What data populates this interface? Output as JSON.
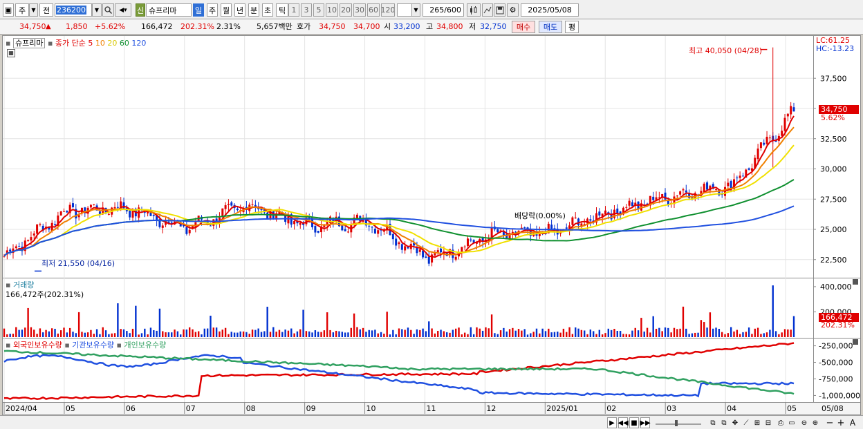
{
  "toolbar": {
    "period_label": "주",
    "prev_label": "전",
    "stock_code": "236200",
    "badge_new": "신",
    "stock_name": "슈프리마",
    "interval_tabs": [
      "일",
      "주",
      "월",
      "년",
      "분",
      "초",
      "틱"
    ],
    "minute_options": [
      "1",
      "3",
      "5",
      "10",
      "20",
      "30",
      "60",
      "120"
    ],
    "count_current": "265",
    "count_total": "/600",
    "date": "2025/05/08"
  },
  "quote": {
    "price": "34,750",
    "change": "1,850",
    "change_pct": "+5.62%",
    "volume": "166,472",
    "volume_ratio": "202.31%",
    "turnover": "2.31%",
    "amount": "5,657백만",
    "ask_label": "호가",
    "ask": "34,750",
    "bid": "34,700",
    "open_label": "시",
    "open": "33,200",
    "high_label": "고",
    "high": "34,800",
    "low_label": "저",
    "low": "32,750",
    "buy_label": "매수",
    "sell_label": "매도",
    "eval_label": "평"
  },
  "price_panel": {
    "name": "슈프리마",
    "ma_label": "종가 단순",
    "ma_periods": [
      "5",
      "10",
      "20",
      "60",
      "120"
    ],
    "ma_colors": [
      "#e00000",
      "#f08000",
      "#f0e000",
      "#109030",
      "#2050e0"
    ],
    "high_annotation": "최고 40,050 (04/28)",
    "low_annotation": "최저 21,550 (04/16)",
    "dividend_annotation": "배당락(0.00%)",
    "lc": "LC:61.25",
    "hc": "HC:-13.23",
    "price_tag": "34,750",
    "pct_tag": "5.62%",
    "y_ticks": [
      "37,500",
      "35,000",
      "32,500",
      "30,000",
      "27,500",
      "25,000",
      "22,500"
    ]
  },
  "volume_panel": {
    "title": "거래량",
    "value": "166,472주(202.31%)",
    "y_ticks": [
      "400,000",
      "200,000"
    ],
    "tag": "166,472",
    "tag_pct": "202.31%"
  },
  "holdings_panel": {
    "foreign": "외국인보유수량",
    "institution": "기관보유수량",
    "individual": "개인보유수량",
    "colors": [
      "#e00000",
      "#2050e0",
      "#30a060"
    ],
    "y_ticks": [
      "-250,000",
      "-500,000",
      "-750,000",
      "-1,000,000"
    ]
  },
  "x_axis": [
    "2024/04",
    "05",
    "06",
    "07",
    "08",
    "09",
    "10",
    "11",
    "12",
    "2025/01",
    "02",
    "03",
    "04",
    "05"
  ],
  "x_end_label": "05/08",
  "chart_data": {
    "type": "candlestick",
    "title": "",
    "y_range": [
      21000,
      41000
    ],
    "monthly_close": [
      {
        "month": "2024/04",
        "value": 22800
      },
      {
        "month": "05",
        "value": 26500
      },
      {
        "month": "06",
        "value": 26800
      },
      {
        "month": "07",
        "value": 25100
      },
      {
        "month": "08",
        "value": 27000
      },
      {
        "month": "09",
        "value": 25300
      },
      {
        "month": "10",
        "value": 25700
      },
      {
        "month": "11",
        "value": 22600
      },
      {
        "month": "12",
        "value": 24500
      },
      {
        "month": "2025/01",
        "value": 24700
      },
      {
        "month": "02",
        "value": 26500
      },
      {
        "month": "03",
        "value": 27800
      },
      {
        "month": "04",
        "value": 28700
      },
      {
        "month": "05",
        "value": 34750
      }
    ],
    "high": {
      "value": 40050,
      "date": "04/28"
    },
    "low": {
      "value": 21550,
      "date": "04/16"
    }
  }
}
